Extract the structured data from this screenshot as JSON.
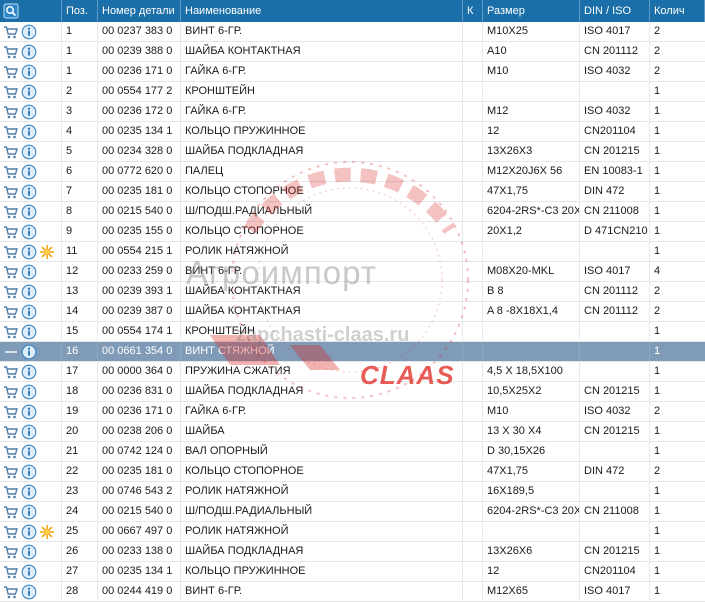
{
  "columns": [
    "Поз.",
    "Номер детали",
    "Наименование",
    "К",
    "Размер",
    "DIN / ISO",
    "Колич"
  ],
  "rows": [
    {
      "pos": "1",
      "part": "00 0237 383 0",
      "name": "ВИНТ 6-ГР.",
      "k": "",
      "size": "M10X25",
      "din": "ISO 4017",
      "qty": "2",
      "star": false
    },
    {
      "pos": "1",
      "part": "00 0239 388 0",
      "name": "ШАЙБА КОНТАКТНАЯ",
      "k": "",
      "size": "A10",
      "din": "CN 201112",
      "qty": "2",
      "star": false
    },
    {
      "pos": "1",
      "part": "00 0236 171 0",
      "name": "ГАЙКА 6-ГР.",
      "k": "",
      "size": "M10",
      "din": "ISO 4032",
      "qty": "2",
      "star": false
    },
    {
      "pos": "2",
      "part": "00 0554 177 2",
      "name": "КРОНШТЕЙН",
      "k": "",
      "size": "",
      "din": "",
      "qty": "1",
      "star": false
    },
    {
      "pos": "3",
      "part": "00 0236 172 0",
      "name": "ГАЙКА 6-ГР.",
      "k": "",
      "size": "M12",
      "din": "ISO 4032",
      "qty": "1",
      "star": false
    },
    {
      "pos": "4",
      "part": "00 0235 134 1",
      "name": "КОЛЬЦО ПРУЖИННОЕ",
      "k": "",
      "size": "12",
      "din": "CN201104",
      "qty": "1",
      "star": false
    },
    {
      "pos": "5",
      "part": "00 0234 328 0",
      "name": "ШАЙБА ПОДКЛАДНАЯ",
      "k": "",
      "size": "13X26X3",
      "din": "CN 201215",
      "qty": "1",
      "star": false
    },
    {
      "pos": "6",
      "part": "00 0772 620 0",
      "name": "ПАЛЕЦ",
      "k": "",
      "size": "M12X20J6X 56",
      "din": "EN 10083-1",
      "qty": "1",
      "star": false
    },
    {
      "pos": "7",
      "part": "00 0235 181 0",
      "name": "КОЛЬЦО СТОПОРНОЕ",
      "k": "",
      "size": "47X1,75",
      "din": "DIN 472",
      "qty": "1",
      "star": false
    },
    {
      "pos": "8",
      "part": "00 0215 540 0",
      "name": "Ш/ПОДШ.РАДИАЛЬНЫЙ",
      "k": "",
      "size": "6204-2RS*-C3  20X",
      "din": "CN 211008",
      "qty": "1",
      "star": false
    },
    {
      "pos": "9",
      "part": "00 0235 155 0",
      "name": "КОЛЬЦО СТОПОРНОЕ",
      "k": "",
      "size": "20X1,2",
      "din": "D  471CN210",
      "qty": "1",
      "star": false
    },
    {
      "pos": "11",
      "part": "00 0554 215 1",
      "name": "РОЛИК НАТЯЖНОЙ",
      "k": "",
      "size": "",
      "din": "",
      "qty": "1",
      "star": true
    },
    {
      "pos": "12",
      "part": "00 0233 259 0",
      "name": "ВИНТ 6-ГР.",
      "k": "",
      "size": "M08X20-MKL",
      "din": "ISO 4017",
      "qty": "4",
      "star": false
    },
    {
      "pos": "13",
      "part": "00 0239 393 1",
      "name": "ШАЙБА КОНТАКТНАЯ",
      "k": "",
      "size": "B 8",
      "din": "CN 201112",
      "qty": "2",
      "star": false
    },
    {
      "pos": "14",
      "part": "00 0239 387 0",
      "name": "ШАЙБА КОНТАКТНАЯ",
      "k": "",
      "size": "A 8 -8X18X1,4",
      "din": "CN 201112",
      "qty": "2",
      "star": false
    },
    {
      "pos": "15",
      "part": "00 0554 174 1",
      "name": "КРОНШТЕЙН",
      "k": "",
      "size": "",
      "din": "",
      "qty": "1",
      "star": false
    },
    {
      "pos": "16",
      "part": "00 0661 354 0",
      "name": "ВИНТ СТЯЖНОЙ",
      "k": "",
      "size": "",
      "din": "",
      "qty": "1",
      "star": false
    },
    {
      "pos": "17",
      "part": "00 0000 364 0",
      "name": "ПРУЖИНА СЖАТИЯ",
      "k": "",
      "size": "4,5 X 18,5X100",
      "din": "",
      "qty": "1",
      "star": false
    },
    {
      "pos": "18",
      "part": "00 0236 831 0",
      "name": "ШАЙБА ПОДКЛАДНАЯ",
      "k": "",
      "size": "10,5X25X2",
      "din": "CN 201215",
      "qty": "1",
      "star": false
    },
    {
      "pos": "19",
      "part": "00 0236 171 0",
      "name": "ГАЙКА 6-ГР.",
      "k": "",
      "size": "M10",
      "din": "ISO 4032",
      "qty": "2",
      "star": false
    },
    {
      "pos": "20",
      "part": "00 0238 206 0",
      "name": "ШАЙБА",
      "k": "",
      "size": "13  X 30  X4",
      "din": "CN 201215",
      "qty": "1",
      "star": false
    },
    {
      "pos": "21",
      "part": "00 0742 124 0",
      "name": "ВАЛ ОПОРНЫЙ",
      "k": "",
      "size": "D 30,15X26",
      "din": "",
      "qty": "1",
      "star": false
    },
    {
      "pos": "22",
      "part": "00 0235 181 0",
      "name": "КОЛЬЦО СТОПОРНОЕ",
      "k": "",
      "size": "47X1,75",
      "din": "DIN 472",
      "qty": "2",
      "star": false
    },
    {
      "pos": "23",
      "part": "00 0746 543 2",
      "name": "РОЛИК НАТЯЖНОЙ",
      "k": "",
      "size": "16X189,5",
      "din": "",
      "qty": "1",
      "star": false
    },
    {
      "pos": "24",
      "part": "00 0215 540 0",
      "name": "Ш/ПОДШ.РАДИАЛЬНЫЙ",
      "k": "",
      "size": "6204-2RS*-C3  20X",
      "din": "CN 211008",
      "qty": "1",
      "star": false
    },
    {
      "pos": "25",
      "part": "00 0667 497 0",
      "name": "РОЛИК НАТЯЖНОЙ",
      "k": "",
      "size": "",
      "din": "",
      "qty": "1",
      "star": true
    },
    {
      "pos": "26",
      "part": "00 0233 138 0",
      "name": "ШАЙБА ПОДКЛАДНАЯ",
      "k": "",
      "size": "13X26X6",
      "din": "CN 201215",
      "qty": "1",
      "star": false
    },
    {
      "pos": "27",
      "part": "00 0235 134 1",
      "name": "КОЛЬЦО ПРУЖИННОЕ",
      "k": "",
      "size": "12",
      "din": "CN201104",
      "qty": "1",
      "star": false
    },
    {
      "pos": "28",
      "part": "00 0244 419 0",
      "name": "ВИНТ 6-ГР.",
      "k": "",
      "size": "M12X65",
      "din": "ISO 4017",
      "qty": "1",
      "star": false
    }
  ],
  "selected_row": 16,
  "watermark": {
    "brand": "Агроимпорт",
    "site": "zapchasti-claas.ru",
    "logo": "CLAAS"
  },
  "colors": {
    "header_bg": "#1b6fa8",
    "selected_bg": "#7f9bb8",
    "cart_icon": "#4f7fa8",
    "info_icon": "#3a86c8",
    "new_star": "#f0a818",
    "watermark_red": "#e0261f"
  },
  "icons": {
    "header": "search-icon",
    "row_cart": "cart-icon",
    "row_info": "info-icon",
    "row_new": "new-star-icon"
  }
}
